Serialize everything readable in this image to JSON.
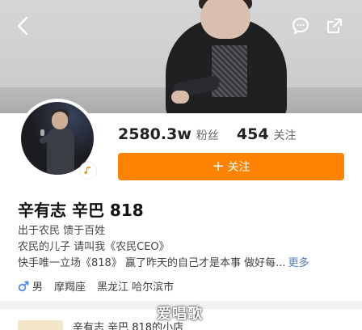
{
  "profile": {
    "followers": "2580.3w",
    "followers_label": "粉丝",
    "following": "454",
    "following_label": "关注",
    "follow_button_label": "关注",
    "follow_button_icon": "plus-icon",
    "name": "辛有志 辛巴 818",
    "bio_lines": [
      "出于农民 馈于百姓",
      "农民的儿子 请叫我《农民CEO》",
      "快手唯一立场《818》 赢了昨天的自己才是本事 做好每..."
    ],
    "more_label": "更多",
    "gender": "男",
    "gender_icon": "male-icon",
    "zodiac": "摩羯座",
    "location": "黑龙江 哈尔滨市",
    "badge_icon": "music-note-icon"
  },
  "next_item": {
    "title": "辛有志 辛巴 818的小店"
  },
  "nav": {
    "back_icon": "back-arrow-icon",
    "comment_icon": "chat-bubble-icon",
    "share_icon": "share-icon"
  },
  "watermark": "爱唱歌",
  "colors": {
    "accent": "#ff8200",
    "link": "#507daf",
    "gender": "#4f8ef0"
  }
}
